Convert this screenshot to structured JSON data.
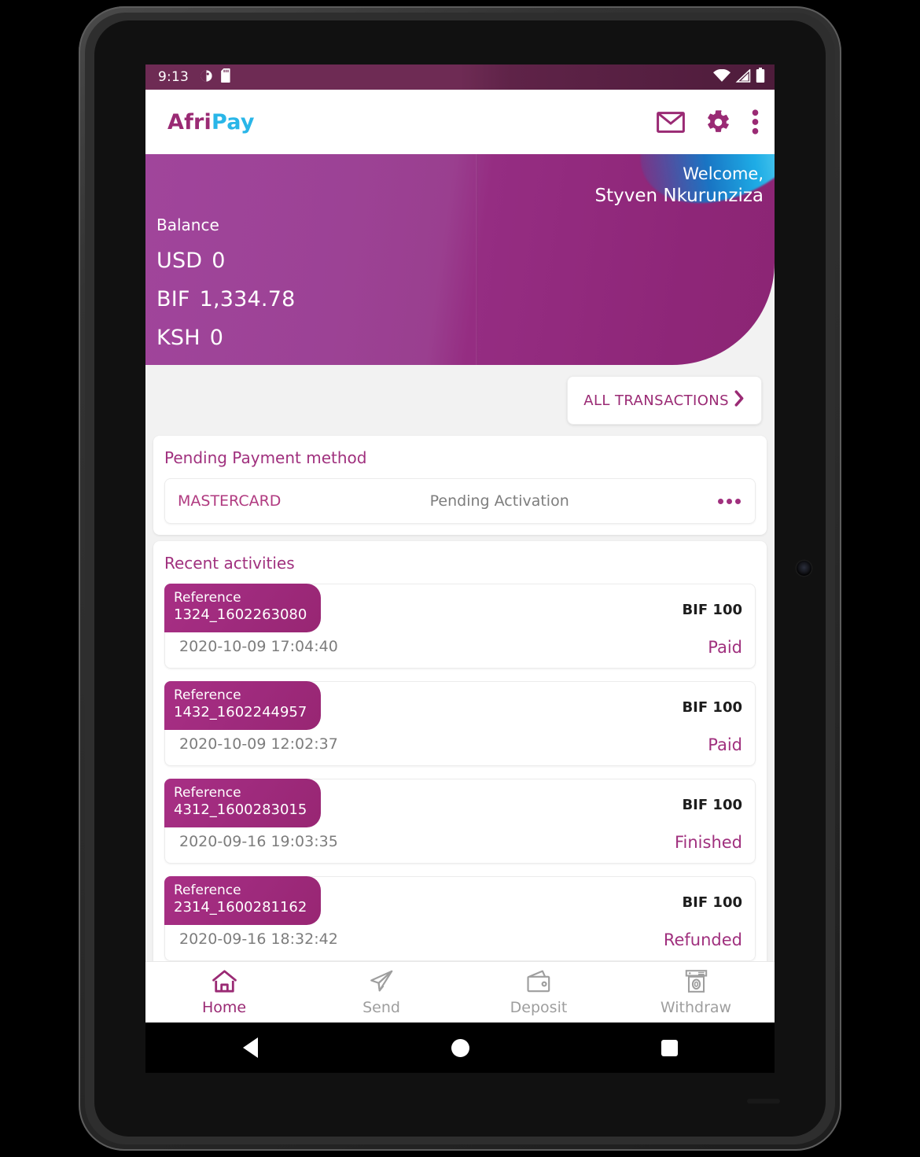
{
  "status_bar": {
    "time": "9:13",
    "left_icons": [
      "dnd-icon",
      "sd-card-icon"
    ],
    "right_icons": [
      "wifi-icon",
      "cellular-signal-icon",
      "battery-icon"
    ]
  },
  "app_bar": {
    "brand_first": "Afri",
    "brand_second": "Pay",
    "icons": [
      "mail-icon",
      "gear-icon",
      "overflow-menu-icon"
    ]
  },
  "balance_card": {
    "welcome_label": "Welcome,",
    "user_name": "Styven Nkurunziza",
    "balance_label": "Balance",
    "balances": [
      {
        "currency": "USD",
        "amount": "0"
      },
      {
        "currency": "BIF",
        "amount": "1,334.78"
      },
      {
        "currency": "KSH",
        "amount": "0"
      }
    ]
  },
  "all_transactions": {
    "label": "ALL TRANSACTIONS",
    "icon": "chevron-right-icon"
  },
  "pending_payment": {
    "title": "Pending Payment method",
    "method": "MASTERCARD",
    "status": "Pending Activation",
    "menu_icon": "more-horizontal-icon"
  },
  "recent_activities": {
    "title": "Recent activities",
    "reference_label": "Reference",
    "items": [
      {
        "reference": "1324_1602263080",
        "amount": "BIF 100",
        "date": "2020-10-09 17:04:40",
        "status": "Paid"
      },
      {
        "reference": "1432_1602244957",
        "amount": "BIF 100",
        "date": "2020-10-09 12:02:37",
        "status": "Paid"
      },
      {
        "reference": "4312_1600283015",
        "amount": "BIF 100",
        "date": "2020-09-16 19:03:35",
        "status": "Finished"
      },
      {
        "reference": "2314_1600281162",
        "amount": "BIF 100",
        "date": "2020-09-16 18:32:42",
        "status": "Refunded"
      }
    ]
  },
  "bottom_nav": {
    "items": [
      {
        "label": "Home",
        "icon": "home-icon",
        "active": true
      },
      {
        "label": "Send",
        "icon": "paper-plane-icon",
        "active": false
      },
      {
        "label": "Deposit",
        "icon": "wallet-icon",
        "active": false
      },
      {
        "label": "Withdraw",
        "icon": "atm-cash-icon",
        "active": false
      }
    ]
  },
  "android_nav": {
    "buttons": [
      "back-button",
      "home-button",
      "recents-button"
    ]
  },
  "colors": {
    "brand_magenta": "#9a2a74",
    "brand_cyan": "#29b6e8",
    "status_bar": "#6e2b54",
    "card_gradient_start": "#a0459b",
    "card_gradient_end": "#8c2574",
    "accent_text": "#a0307e",
    "muted_text": "#7d7d7d",
    "page_background": "#f2f2f2"
  }
}
